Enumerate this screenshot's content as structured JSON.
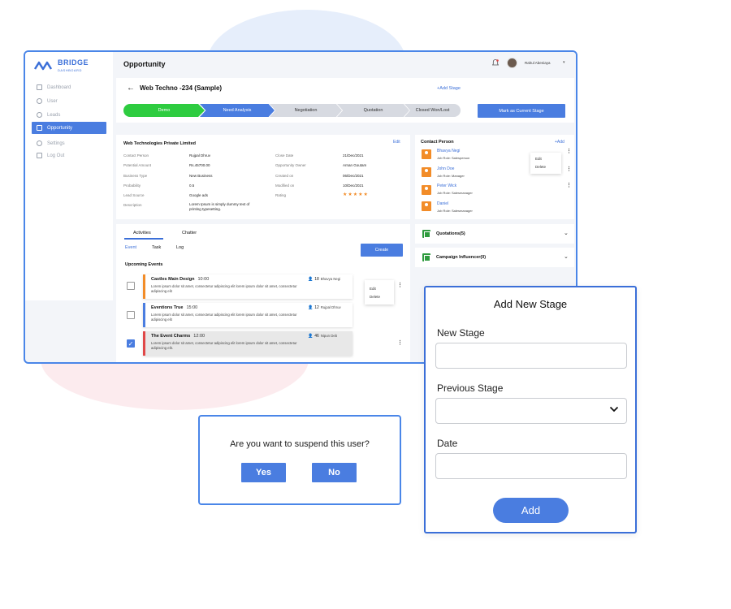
{
  "app": {
    "brand": "BRIDGE",
    "brand_sub": "DASHBOARD",
    "page_title": "Opportunity",
    "user_name": "Rahul Abeniaya"
  },
  "sidebar": {
    "items": [
      {
        "label": "Dashboard",
        "icon": "grid-icon",
        "active": false
      },
      {
        "label": "User",
        "icon": "user-icon",
        "active": false
      },
      {
        "label": "Leads",
        "icon": "users-icon",
        "active": false
      },
      {
        "label": "Opportunity",
        "icon": "chart-icon",
        "active": true
      },
      {
        "label": "Settings",
        "icon": "gear-icon",
        "active": false
      },
      {
        "label": "Log Out",
        "icon": "logout-icon",
        "active": false
      }
    ]
  },
  "header": {
    "opportunity_name": "Web Techno -234 (Sample)",
    "add_stage": "+Add Stage",
    "stages": [
      "Demo",
      "Need Analysis",
      "Negotiation",
      "Quotation",
      "Closed Won/Lost"
    ],
    "current_stage_index": 0,
    "mark_button": "Mark as Current Stage"
  },
  "company": {
    "name": "Web Technologies Private Limited",
    "edit": "Edit",
    "left": [
      {
        "label": "Contact Person",
        "value": "Rujpal Dhruv"
      },
      {
        "label": "Potential Amount",
        "value": "Rs.45700.00"
      },
      {
        "label": "Business Type",
        "value": "New Business"
      },
      {
        "label": "Probability",
        "value": "0.5"
      },
      {
        "label": "Lead Source",
        "value": "Google ads"
      },
      {
        "label": "Description",
        "value": "Lorem Ipsum is simply dummy text of printing typesetting."
      }
    ],
    "right": [
      {
        "label": "Close Date",
        "value": "21/Dec/2021"
      },
      {
        "label": "Opportunity Owner",
        "value": "Arnan Goutam"
      },
      {
        "label": "Created on",
        "value": "06/Dec/2021"
      },
      {
        "label": "Modified on",
        "value": "10/Dec/2021"
      },
      {
        "label": "Rating",
        "value": "★★★★★"
      }
    ],
    "rating": 5
  },
  "contacts": {
    "title": "Contact Person",
    "add": "+Add",
    "items": [
      {
        "name": "Bhavya Negi",
        "role": "Job Role: Salesperson"
      },
      {
        "name": "John Doe",
        "role": "Job Role: Manager"
      },
      {
        "name": "Peter Wick",
        "role": "Job Role: Salesmanager"
      },
      {
        "name": "Daniel",
        "role": "Job Role: Salesmanager"
      }
    ],
    "menu": {
      "edit": "Edit",
      "delete": "Delete"
    }
  },
  "sections": [
    {
      "title": "Quotations(5)"
    },
    {
      "title": "Campaign Influencer(0)"
    }
  ],
  "activities": {
    "tabs": [
      "Activities",
      "Chatter"
    ],
    "subtabs": [
      "Event",
      "Task",
      "Log"
    ],
    "create": "Create",
    "upcoming": "Upcoming Events",
    "events": [
      {
        "title": "Castles Main Design",
        "time": "10:00",
        "desc": "Lorem ipsum dolor sit amet, consectetur adipiscing elit lorem ipsum dolor sit amet, consectetur adipiscing elit",
        "count": "18",
        "who": "Bhavya Negi",
        "checked": false,
        "color": "#f28c28"
      },
      {
        "title": "Eventions True",
        "time": "15:00",
        "desc": "Lorem ipsum dolor sit amet, consectetur adipiscing elit lorem ipsum dolor sit amet, consectetur adipiscing elit",
        "count": "12",
        "who": "Rujpal Dhruv",
        "checked": false,
        "color": "#4a7de0"
      },
      {
        "title": "The Event Charms",
        "time": "12:00",
        "desc": "Lorem ipsum dolor sit amet, consectetur adipiscing elit lorem ipsum dolor sit amet, consectetur adipiscing elit.",
        "count": "46",
        "who": "Nipun Deb",
        "checked": true,
        "color": "#e04848"
      }
    ],
    "menu": {
      "edit": "Edit",
      "delete": "Delete"
    }
  },
  "modal": {
    "title": "Add New Stage",
    "new_stage_label": "New Stage",
    "previous_stage_label": "Previous Stage",
    "date_label": "Date",
    "add_button": "Add"
  },
  "dialog": {
    "text": "Are you want to suspend this user?",
    "yes": "Yes",
    "no": "No"
  },
  "colors": {
    "accent": "#4a7de0",
    "active_stage": "#2ecc40",
    "frame_border": "#4a86e8",
    "orange": "#f28c28",
    "green": "#2e9b3e"
  }
}
